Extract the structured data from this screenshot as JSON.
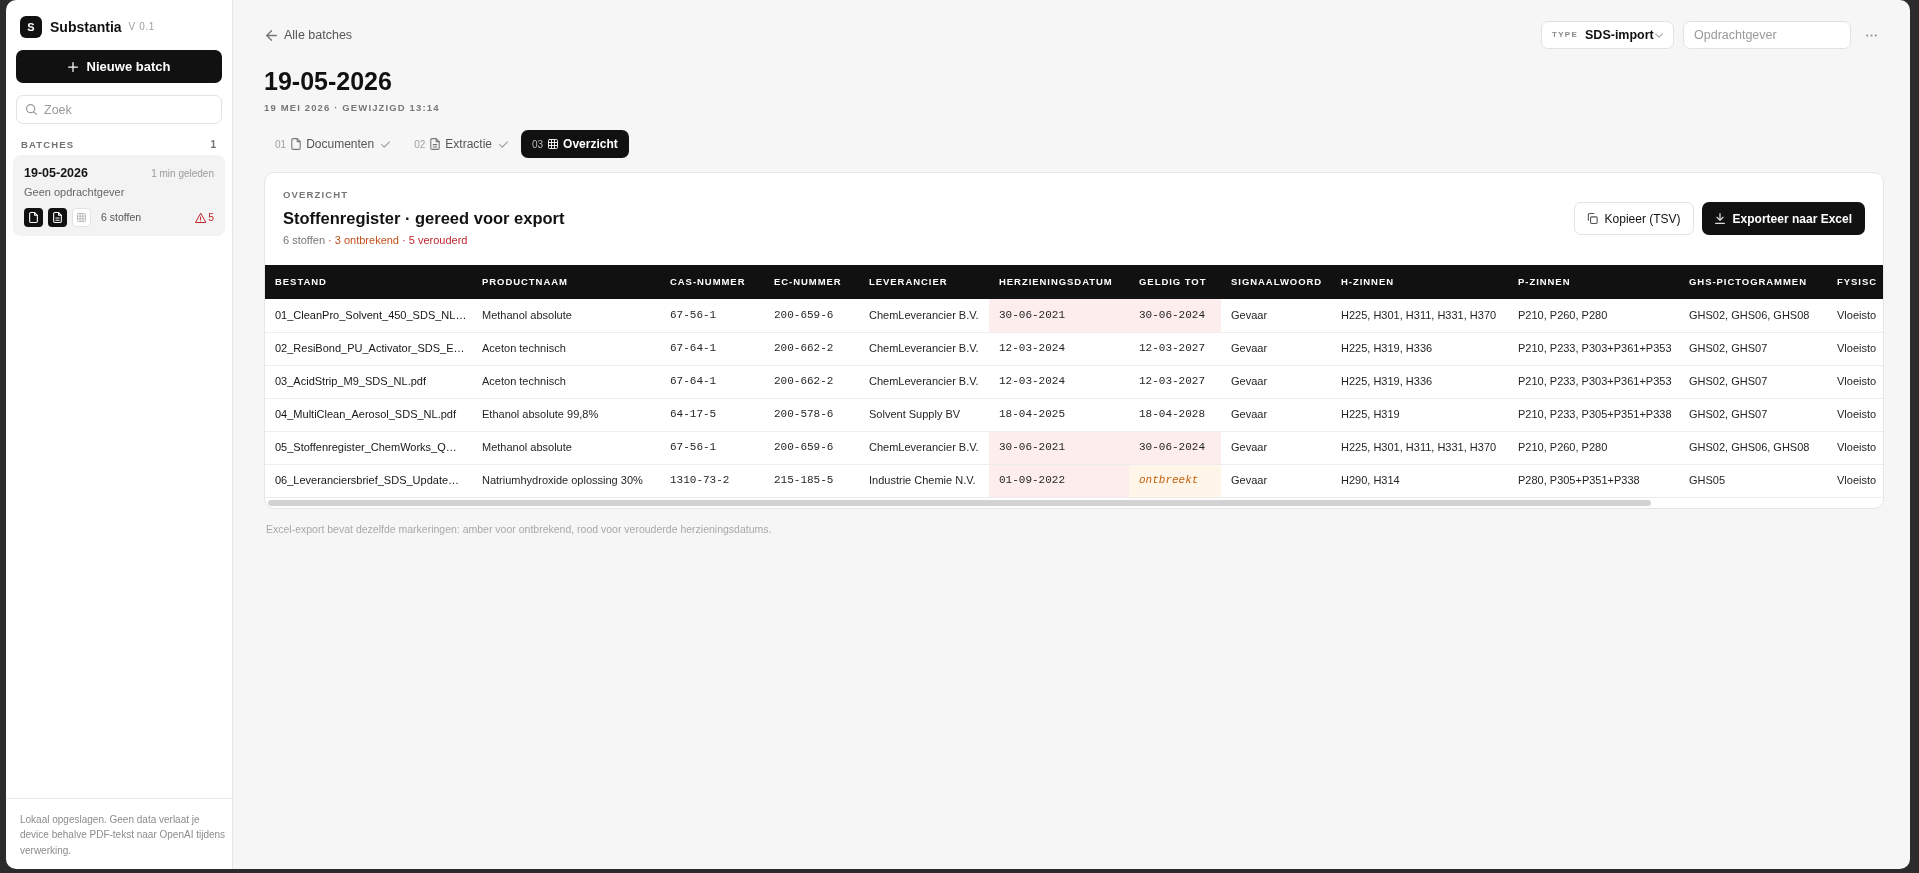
{
  "app": {
    "logo": "S",
    "name": "Substantia",
    "version": "V 0.1"
  },
  "sidebar": {
    "new_button": "Nieuwe batch",
    "search": {
      "placeholder": "Zoek"
    },
    "section": {
      "label": "BATCHES",
      "count": "1"
    },
    "batches": [
      {
        "title": "19-05-2026",
        "time": "1 min geleden",
        "client": "Geen opdrachtgever",
        "selected": true,
        "steps": [
          {
            "done": true
          },
          {
            "done": true
          },
          {
            "done": false
          }
        ],
        "count": "6 stoffen",
        "warnings": "5"
      }
    ],
    "footer": "Lokaal opgeslagen. Geen data verlaat je device behalve PDF-tekst naar OpenAI tijdens verwerking."
  },
  "header": {
    "back_link": "Alle batches",
    "type_select": {
      "label": "TYPE",
      "value": "SDS-import"
    },
    "client_field": {
      "placeholder": "Opdrachtgever"
    }
  },
  "batch": {
    "title": "19-05-2026",
    "meta": "19 MEI 2026 · GEWIJZIGD 13:14"
  },
  "tabs": [
    {
      "number": "01",
      "label": "Documenten",
      "done": true,
      "selected": false
    },
    {
      "number": "02",
      "label": "Extractie",
      "done": true,
      "selected": false
    },
    {
      "number": "03",
      "label": "Overzicht",
      "done": false,
      "selected": true
    }
  ],
  "panel": {
    "eyebrow": "OVERZICHT",
    "title": "Stoffenregister · gereed voor export",
    "summary": [
      {
        "text": "6 stoffen",
        "color": "#777777"
      },
      {
        "text": "· 3 ontbrekend",
        "color": "#c4501a"
      },
      {
        "text": "· 5 verouderd",
        "color": "#c0262d"
      }
    ],
    "buttons": [
      {
        "kind": "copy",
        "label": "Kopieer (TSV)"
      },
      {
        "kind": "export",
        "label": "Exporteer naar Excel"
      }
    ]
  },
  "table": {
    "columns": [
      {
        "label": "BESTAND",
        "kind": "file"
      },
      {
        "label": "PRODUCTNAAM",
        "kind": "text"
      },
      {
        "label": "CAS-NUMMER",
        "kind": "code"
      },
      {
        "label": "EC-NUMMER",
        "kind": "code"
      },
      {
        "label": "LEVERANCIER",
        "kind": "text"
      },
      {
        "label": "HERZIENINGSDATUM",
        "kind": "code"
      },
      {
        "label": "GELDIG TOT",
        "kind": "code"
      },
      {
        "label": "SIGNAALWOORD",
        "kind": "text"
      },
      {
        "label": "H-ZINNEN",
        "kind": "text"
      },
      {
        "label": "P-ZINNEN",
        "kind": "text"
      },
      {
        "label": "GHS-PICTOGRAMMEN",
        "kind": "text"
      },
      {
        "label": "FYSISC",
        "kind": "text"
      }
    ],
    "rows": [
      {
        "cells": [
          {
            "text": "01_CleanPro_Solvent_450_SDS_NL…",
            "outdated": false,
            "missing": false
          },
          {
            "text": "Methanol absolute",
            "outdated": false,
            "missing": false
          },
          {
            "text": "67-56-1",
            "outdated": false,
            "missing": false
          },
          {
            "text": "200-659-6",
            "outdated": false,
            "missing": false
          },
          {
            "text": "ChemLeverancier B.V.",
            "outdated": false,
            "missing": false
          },
          {
            "text": "30-06-2021",
            "outdated": true,
            "missing": false
          },
          {
            "text": "30-06-2024",
            "outdated": true,
            "missing": false
          },
          {
            "text": "Gevaar",
            "outdated": false,
            "missing": false
          },
          {
            "text": "H225, H301, H311, H331, H370",
            "outdated": false,
            "missing": false
          },
          {
            "text": "P210, P260, P280",
            "outdated": false,
            "missing": false
          },
          {
            "text": "GHS02, GHS06, GHS08",
            "outdated": false,
            "missing": false
          },
          {
            "text": "Vloeisto",
            "outdated": false,
            "missing": false
          }
        ]
      },
      {
        "cells": [
          {
            "text": "02_ResiBond_PU_Activator_SDS_E…",
            "outdated": false,
            "missing": false
          },
          {
            "text": "Aceton technisch",
            "outdated": false,
            "missing": false
          },
          {
            "text": "67-64-1",
            "outdated": false,
            "missing": false
          },
          {
            "text": "200-662-2",
            "outdated": false,
            "missing": false
          },
          {
            "text": "ChemLeverancier B.V.",
            "outdated": false,
            "missing": false
          },
          {
            "text": "12-03-2024",
            "outdated": false,
            "missing": false
          },
          {
            "text": "12-03-2027",
            "outdated": false,
            "missing": false
          },
          {
            "text": "Gevaar",
            "outdated": false,
            "missing": false
          },
          {
            "text": "H225, H319, H336",
            "outdated": false,
            "missing": false
          },
          {
            "text": "P210, P233, P303+P361+P353",
            "outdated": false,
            "missing": false
          },
          {
            "text": "GHS02, GHS07",
            "outdated": false,
            "missing": false
          },
          {
            "text": "Vloeisto",
            "outdated": false,
            "missing": false
          }
        ]
      },
      {
        "cells": [
          {
            "text": "03_AcidStrip_M9_SDS_NL.pdf",
            "outdated": false,
            "missing": false
          },
          {
            "text": "Aceton technisch",
            "outdated": false,
            "missing": false
          },
          {
            "text": "67-64-1",
            "outdated": false,
            "missing": false
          },
          {
            "text": "200-662-2",
            "outdated": false,
            "missing": false
          },
          {
            "text": "ChemLeverancier B.V.",
            "outdated": false,
            "missing": false
          },
          {
            "text": "12-03-2024",
            "outdated": false,
            "missing": false
          },
          {
            "text": "12-03-2027",
            "outdated": false,
            "missing": false
          },
          {
            "text": "Gevaar",
            "outdated": false,
            "missing": false
          },
          {
            "text": "H225, H319, H336",
            "outdated": false,
            "missing": false
          },
          {
            "text": "P210, P233, P303+P361+P353",
            "outdated": false,
            "missing": false
          },
          {
            "text": "GHS02, GHS07",
            "outdated": false,
            "missing": false
          },
          {
            "text": "Vloeisto",
            "outdated": false,
            "missing": false
          }
        ]
      },
      {
        "cells": [
          {
            "text": "04_MultiClean_Aerosol_SDS_NL.pdf",
            "outdated": false,
            "missing": false
          },
          {
            "text": "Ethanol absolute 99,8%",
            "outdated": false,
            "missing": false
          },
          {
            "text": "64-17-5",
            "outdated": false,
            "missing": false
          },
          {
            "text": "200-578-6",
            "outdated": false,
            "missing": false
          },
          {
            "text": "Solvent Supply BV",
            "outdated": false,
            "missing": false
          },
          {
            "text": "18-04-2025",
            "outdated": false,
            "missing": false
          },
          {
            "text": "18-04-2028",
            "outdated": false,
            "missing": false
          },
          {
            "text": "Gevaar",
            "outdated": false,
            "missing": false
          },
          {
            "text": "H225, H319",
            "outdated": false,
            "missing": false
          },
          {
            "text": "P210, P233, P305+P351+P338",
            "outdated": false,
            "missing": false
          },
          {
            "text": "GHS02, GHS07",
            "outdated": false,
            "missing": false
          },
          {
            "text": "Vloeisto",
            "outdated": false,
            "missing": false
          }
        ]
      },
      {
        "cells": [
          {
            "text": "05_Stoffenregister_ChemWorks_Q…",
            "outdated": false,
            "missing": false
          },
          {
            "text": "Methanol absolute",
            "outdated": false,
            "missing": false
          },
          {
            "text": "67-56-1",
            "outdated": false,
            "missing": false
          },
          {
            "text": "200-659-6",
            "outdated": false,
            "missing": false
          },
          {
            "text": "ChemLeverancier B.V.",
            "outdated": false,
            "missing": false
          },
          {
            "text": "30-06-2021",
            "outdated": true,
            "missing": false
          },
          {
            "text": "30-06-2024",
            "outdated": true,
            "missing": false
          },
          {
            "text": "Gevaar",
            "outdated": false,
            "missing": false
          },
          {
            "text": "H225, H301, H311, H331, H370",
            "outdated": false,
            "missing": false
          },
          {
            "text": "P210, P260, P280",
            "outdated": false,
            "missing": false
          },
          {
            "text": "GHS02, GHS06, GHS08",
            "outdated": false,
            "missing": false
          },
          {
            "text": "Vloeisto",
            "outdated": false,
            "missing": false
          }
        ]
      },
      {
        "cells": [
          {
            "text": "06_Leveranciersbrief_SDS_Update…",
            "outdated": false,
            "missing": false
          },
          {
            "text": "Natriumhydroxide oplossing 30%",
            "outdated": false,
            "missing": false
          },
          {
            "text": "1310-73-2",
            "outdated": false,
            "missing": false
          },
          {
            "text": "215-185-5",
            "outdated": false,
            "missing": false
          },
          {
            "text": "Industrie Chemie N.V.",
            "outdated": false,
            "missing": false
          },
          {
            "text": "01-09-2022",
            "outdated": true,
            "missing": false
          },
          {
            "text": "ontbreekt",
            "outdated": false,
            "missing": true
          },
          {
            "text": "Gevaar",
            "outdated": false,
            "missing": false
          },
          {
            "text": "H290, H314",
            "outdated": false,
            "missing": false
          },
          {
            "text": "P280, P305+P351+P338",
            "outdated": false,
            "missing": false
          },
          {
            "text": "GHS05",
            "outdated": false,
            "missing": false
          },
          {
            "text": "Vloeisto",
            "outdated": false,
            "missing": false
          }
        ]
      }
    ]
  },
  "note": "Excel-export bevat dezelfde markeringen: amber voor ontbrekend, rood voor verouderde herzieningsdatums."
}
